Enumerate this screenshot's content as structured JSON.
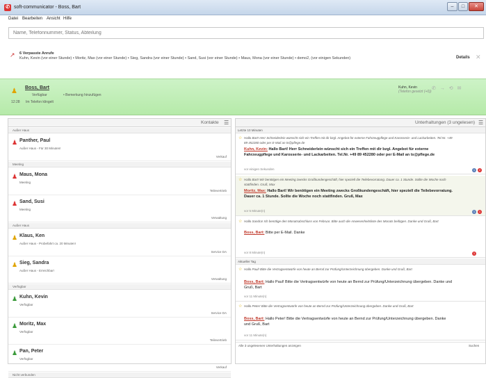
{
  "window": {
    "title": "soft-communicator - Boss, Bart"
  },
  "menu": [
    "Datei",
    "Bearbeiten",
    "Ansicht",
    "Hilfe"
  ],
  "search": {
    "placeholder": "Name, Telefonnummer, Status, Abteilung"
  },
  "missed": {
    "title": "6 Verpasste Anrufe",
    "list": "Kuhn, Kevin (vor einer Stunde) • Moritz, Max (vor einer Stunde) • Sieg, Sandra (vor einer Stunde) • Sand, Susi (vor einer Stunde) • Maus, Mona (vor einer Stunde) • demo2, (vor einigen Sekunden)",
    "details_label": "Details"
  },
  "me": {
    "name": "Boss, Bart",
    "state": "Verfügbar",
    "note": "• Bemerkung hinzufügen",
    "time": "12:28",
    "phone": "Im Telefon klingelt"
  },
  "active_call": {
    "name": "Kuhn, Kevin",
    "sub": "(Telefon gesetzt (+0))"
  },
  "contacts_header": "Kontakte",
  "conversations_header": "Unterhaltungen (3 ungelesen)",
  "contacts": [
    {
      "group": "Außer Haus"
    },
    {
      "name": "Panther, Paul",
      "sub": "Außer Haus - Für 30 Minuten!",
      "dep": "Verkauf",
      "color": "#d33"
    },
    {
      "group": "Meeting"
    },
    {
      "name": "Maus, Mona",
      "sub": "Meeting",
      "dep": "Teilevertrieb",
      "color": "#d33"
    },
    {
      "name": "Sand, Susi",
      "sub": "Meeting",
      "dep": "Verwaltung",
      "color": "#d33"
    },
    {
      "group": "Außer Haus"
    },
    {
      "name": "Klaus, Ken",
      "sub": "Außer Haus - Probefahrt ca. 20 Minuten!",
      "dep": "Service DA",
      "color": "#e0a400"
    },
    {
      "name": "Sieg, Sandra",
      "sub": "Außer Haus - Erreichbar!",
      "dep": "Verwaltung",
      "color": "#e0a400"
    },
    {
      "group": "Verfügbar"
    },
    {
      "name": "Kuhn, Kevin",
      "sub": "Verfügbar",
      "dep": "Service DA",
      "color": "#3a9a3a"
    },
    {
      "name": "Moritz, Max",
      "sub": "Verfügbar",
      "dep": "Teilevertrieb",
      "color": "#3a9a3a"
    },
    {
      "name": "Pan, Peter",
      "sub": "Verfügbar",
      "dep": "Verkauf",
      "color": "#3a9a3a"
    },
    {
      "group": "Nicht verbunden"
    }
  ],
  "conversations": {
    "sec1": "Letzte 10 Minuten",
    "sec2": "Aktueller Tag",
    "items": [
      {
        "q": "Hallo Bart! Herr Schneiderlein wünscht sich ein Treffen mit dir bzgl. Angebot für externe Fahrzeugpflege und Karosserie- und Lackarbeiten. Tel.Nr. +49 89 452280 oder per E-Mail an ts@pflege.de",
        "sender": "Kuhn, Kevin:",
        "r": "Hallo Bart! Herr Schneiderlein wünscht sich ein Treffen mit dir bzgl. Angebot für externe Fahrzeugpflege und Karosserie- und Lackarbeiten. Tel.Nr. +49 89 452280 oder per E-Mail an ts@pflege.de",
        "t": "vor einigen Sekunden"
      },
      {
        "q": "Hallo Bart! Wir benötigen ein Meeting zwecks Großkundengeschäft, hier speziell die Teilebevorratung. Dauer ca. 1 Stunde. Sollte die Woche noch stattfinden. Gruß, Max",
        "sender": "Moritz, Max:",
        "r": "Hallo Bart! Wir benötigen ein Meeting zwecks Großkundengeschäft, hier speziell die Teilebevorratung. Dauer ca. 1 Stunde. Sollte die Woche noch stattfinden. Gruß, Max",
        "t": "vor 5 Minute(n)"
      },
      {
        "q": "Hallo Sandra! Ich benötige den Monatsabschluss von Februar. Bitte auch die Anwesenheitsliste des Monats beifügen. Danke und Gruß, Bart",
        "sender": "Boss, Bart:",
        "r": "Bitte per E-Mail. Danke",
        "t": "vor 8 Minute(n)"
      },
      {
        "q": "Hallo Paul! Bitte die Vertragsentwürfe von heute an Bernd zur Prüfung/Unterzeichnung übergeben. Danke und Gruß, Bart",
        "sender": "Boss, Bart:",
        "r": "Hallo Paul! Bitte die Vertragsentwürfe von heute an Bernd zur Prüfung/Unterzeichnung übergeben. Danke und Gruß, Bart",
        "t": "vor 11 Minute(n)"
      },
      {
        "q": "Hallo Peter! Bitte die Vertragsentwürfe von heute an Bernd zur Prüfung/Unterzeichnung übergeben. Danke und Gruß, Bart",
        "sender": "Boss, Bart:",
        "r": "Hallo Peter! Bitte die Vertragsentwürfe von heute an Bernd zur Prüfung/Unterzeichnung übergeben. Danke und Gruß, Bart",
        "t": "vor 11 Minute(n)"
      }
    ],
    "footer_left": "Alle 3 ungelesenen Unterhaltungen anzeigen",
    "footer_right": "Suchen"
  }
}
